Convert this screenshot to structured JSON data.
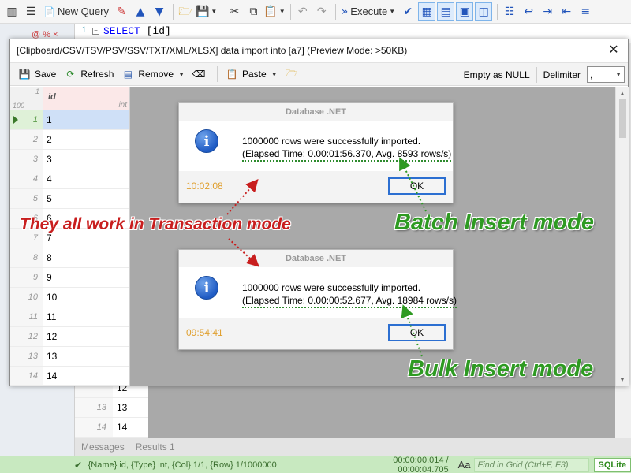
{
  "toolbar": {
    "new_query_label": "New Query",
    "execute_label": "Execute"
  },
  "editor": {
    "line_number": "1",
    "keyword": "SELECT",
    "rest": " [id]"
  },
  "left_strip": {
    "marks": "@ % ×"
  },
  "import_window": {
    "title": "[Clipboard/CSV/TSV/PSV/SSV/TXT/XML/XLSX] data import into [a7] (Preview Mode: >50KB)",
    "toolbar": {
      "save": "Save",
      "refresh": "Refresh",
      "remove": "Remove",
      "paste": "Paste",
      "empty_as_null": "Empty as NULL",
      "delimiter_label": "Delimiter",
      "delimiter_value": ","
    },
    "grid": {
      "corner_top": "1",
      "corner_bottom": "100",
      "column_name": "id",
      "column_type": "int",
      "rows": [
        {
          "n": "1",
          "v": "1"
        },
        {
          "n": "2",
          "v": "2"
        },
        {
          "n": "3",
          "v": "3"
        },
        {
          "n": "4",
          "v": "4"
        },
        {
          "n": "5",
          "v": "5"
        },
        {
          "n": "6",
          "v": "6"
        },
        {
          "n": "7",
          "v": "7"
        },
        {
          "n": "8",
          "v": "8"
        },
        {
          "n": "9",
          "v": "9"
        },
        {
          "n": "10",
          "v": "10"
        },
        {
          "n": "11",
          "v": "11"
        },
        {
          "n": "12",
          "v": "12"
        },
        {
          "n": "13",
          "v": "13"
        },
        {
          "n": "14",
          "v": "14"
        }
      ]
    }
  },
  "dialog_batch": {
    "caption": "Database .NET",
    "line1": "1000000 rows were successfully imported.",
    "line2": "(Elapsed Time: 0.00:01:56.370, Avg. 8593 rows/s)",
    "time": "10:02:08",
    "ok": "OK"
  },
  "dialog_bulk": {
    "caption": "Database .NET",
    "line1": "1000000 rows were successfully imported.",
    "line2": "(Elapsed Time: 0.00:00:52.677, Avg. 18984 rows/s)",
    "time": "09:54:41",
    "ok": "OK"
  },
  "annotations": {
    "transaction": "They all work in Transaction mode",
    "batch": "Batch Insert mode",
    "bulk": "Bulk Insert mode"
  },
  "background_grid": {
    "rows": [
      {
        "n": "",
        "v": "12"
      },
      {
        "n": "13",
        "v": "13"
      },
      {
        "n": "14",
        "v": "14"
      }
    ]
  },
  "bottom_tabs": {
    "messages": "Messages",
    "results": "Results 1"
  },
  "status": {
    "info": "{Name} id, {Type} int, {Col} 1/1, {Row} 1/1000000",
    "timing": "00:00:00.014 / 00:00:04.705",
    "aa": "Aa",
    "find_placeholder": "Find in Grid (Ctrl+F, F3)",
    "engine": "SQLite"
  },
  "colors": {
    "annotation_red": "#c81e1e",
    "annotation_green": "#2e9a22",
    "status_green": "#c8e9c0",
    "ok_border": "#2c6fd1",
    "time_orange": "#e0a030"
  }
}
